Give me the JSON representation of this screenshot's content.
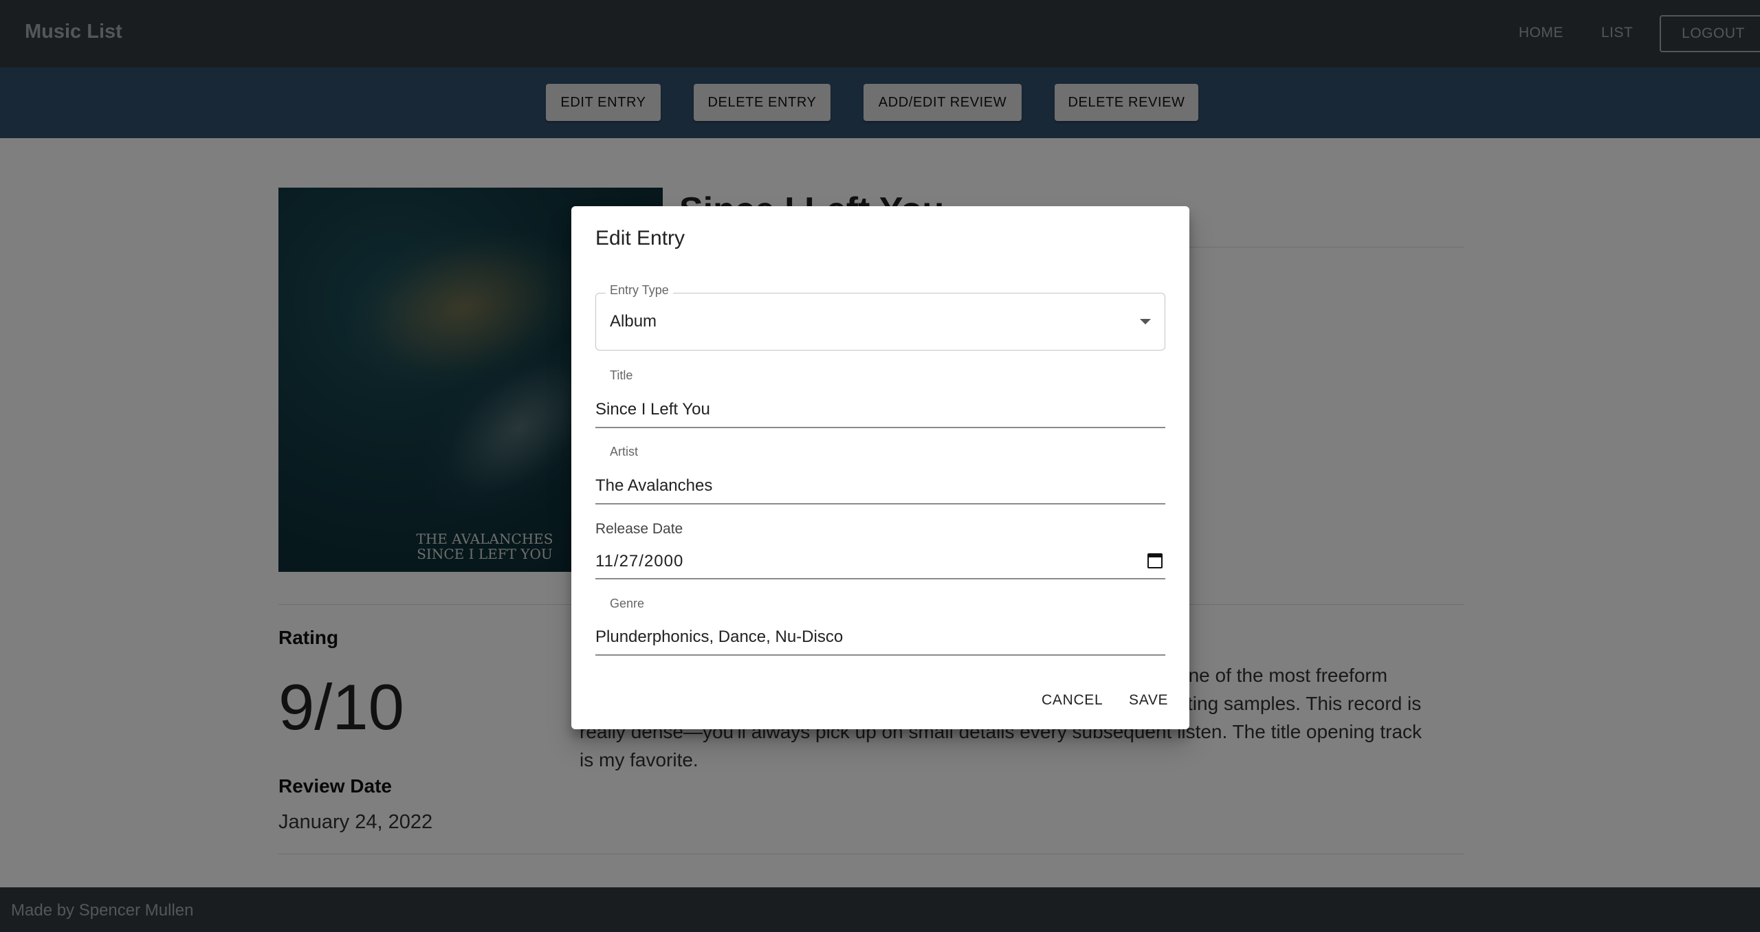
{
  "app": {
    "brand": "Music List"
  },
  "nav": {
    "home": "HOME",
    "list": "LIST",
    "logout": "LOGOUT"
  },
  "toolbar": {
    "edit_entry": "EDIT ENTRY",
    "delete_entry": "DELETE ENTRY",
    "add_edit_review": "ADD/EDIT REVIEW",
    "delete_review": "DELETE REVIEW"
  },
  "album": {
    "title": "Since I Left You",
    "art_caption_line1": "THE AVALANCHES",
    "art_caption_line2": "SINCE I LEFT YOU"
  },
  "review": {
    "rating_label": "Rating",
    "rating_value": "9/10",
    "date_label": "Review Date",
    "date_value": "January 24, 2022",
    "text_line1": "one of the most freeform",
    "text_line2": "sting samples. This record is",
    "text_line3": "really dense—you'll always pick up on small details every subsequent listen. The title opening track",
    "text_line4": "is my favorite."
  },
  "footer": {
    "text": "Made by Spencer Mullen"
  },
  "dialog": {
    "title": "Edit Entry",
    "entry_type_label": "Entry Type",
    "entry_type_value": "Album",
    "title_label": "Title",
    "title_value": "Since I Left You",
    "artist_label": "Artist",
    "artist_value": "The Avalanches",
    "release_date_label": "Release Date",
    "release_date_value": "11/27/2000",
    "genre_label": "Genre",
    "genre_value": "Plunderphonics, Dance, Nu-Disco",
    "cancel": "CANCEL",
    "save": "SAVE"
  },
  "icons": {
    "dropdown": "chevron-down-icon",
    "calendar": "calendar-icon"
  },
  "colors": {
    "navbar": "#343a40",
    "toolbar": "#33506f",
    "button": "#e0e0e0",
    "overlay": "rgba(0,0,0,0.5)"
  }
}
